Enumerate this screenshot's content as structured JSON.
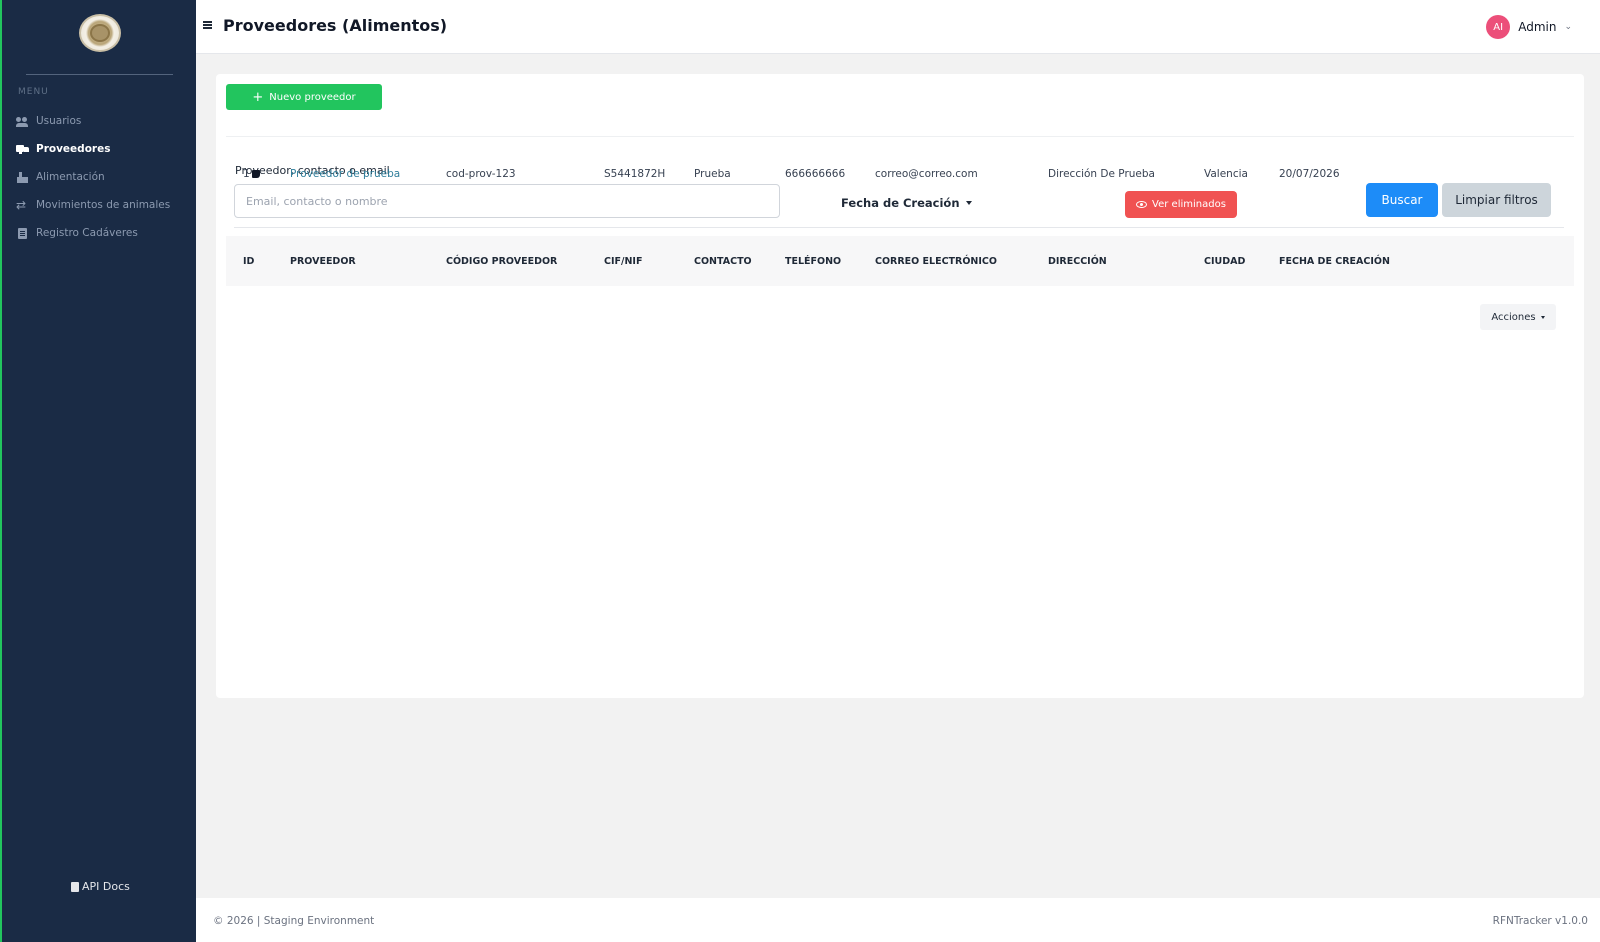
{
  "sidebar": {
    "menu_title": "MENU",
    "items": [
      {
        "label": "Usuarios",
        "icon": "users-icon"
      },
      {
        "label": "Proveedores",
        "icon": "truck-icon",
        "active": true
      },
      {
        "label": "Alimentación",
        "icon": "food-icon"
      },
      {
        "label": "Movimientos de animales",
        "icon": "arrows-icon"
      },
      {
        "label": "Registro Cadáveres",
        "icon": "document-icon"
      }
    ],
    "api_docs_label": "API Docs"
  },
  "header": {
    "title": "Proveedores (Alimentos)",
    "user": {
      "initials": "AI",
      "name": "Admin"
    }
  },
  "toolbar": {
    "new_button_label": "Nuevo proveedor"
  },
  "filters": {
    "search_label": "Proveedor, contacto o email",
    "search_placeholder": "Email, contacto o nombre",
    "search_value": "",
    "date_filter_label": "Fecha de Creación",
    "deleted_button_label": "Ver eliminados",
    "search_button_label": "Buscar",
    "clear_button_label": "Limpiar filtros"
  },
  "table": {
    "headers": [
      "ID",
      "PROVEEDOR",
      "CÓDIGO PROVEEDOR",
      "CIF/NIF",
      "CONTACTO",
      "TELÉFONO",
      "CORREO ELECTRÓNICO",
      "DIRECCIÓN",
      "CIUDAD",
      "FECHA DE CREACIÓN"
    ],
    "rows": [
      {
        "id": "1",
        "proveedor": "Proveedor de prueba",
        "codigo": "cod-prov-123",
        "cif": "S5441872H",
        "contacto": "Prueba",
        "telefono": "666666666",
        "correo": "correo@correo.com",
        "direccion": "Dirección De Prueba",
        "ciudad": "Valencia",
        "fecha": "20/07/2026",
        "actions_label": "Acciones"
      }
    ]
  },
  "footer": {
    "left": "© 2026 | Staging Environment",
    "right": "RFNTracker v1.0.0"
  },
  "colors": {
    "sidebar_bg": "#1a2b45",
    "primary_green": "#22c55e",
    "danger_red": "#f05252",
    "primary_blue": "#1d8cf8",
    "avatar_pink": "#ec4f7a"
  }
}
